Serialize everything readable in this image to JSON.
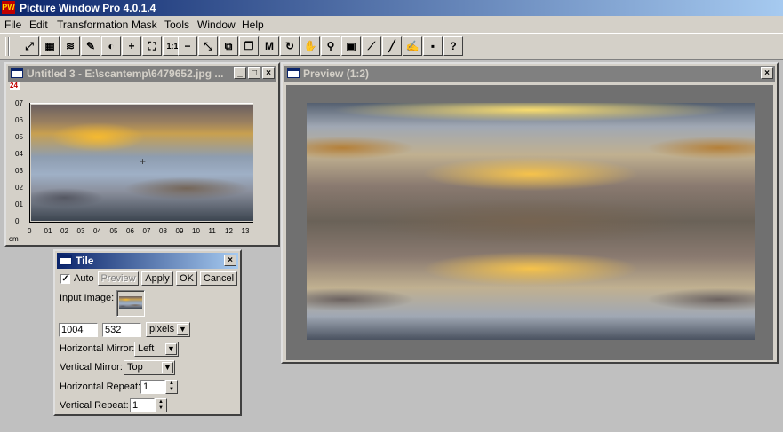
{
  "app": {
    "title": "Picture Window Pro 4.0.1.4",
    "logo": "PW"
  },
  "menu": [
    "File",
    "Edit",
    "Transformation",
    "Mask",
    "Tools",
    "Window",
    "Help"
  ],
  "toolbar": {
    "icons": [
      "transform-icon",
      "grid-icon",
      "waves-icon",
      "sharpen-icon",
      "brightness-icon",
      "plus-icon",
      "fit-icon",
      "one-to-one-icon",
      "minus-icon",
      "shrink-icon",
      "compare-icon",
      "copy-icon",
      "mask-icon",
      "circle-arrow-icon",
      "hand-icon",
      "magnifier-icon",
      "color-sample-icon",
      "brush-icon",
      "pen-icon",
      "paint-icon",
      "camera-icon",
      "help-icon"
    ],
    "glyphs": [
      "⤢",
      "▦",
      "≋",
      "✎",
      "◐",
      "+",
      "⛶",
      "1:1",
      "−",
      "⤡",
      "⧉",
      "❐",
      "M",
      "↻",
      "✋",
      "⚲",
      "▣",
      "⟋",
      "╱",
      "✍",
      "▪",
      "?"
    ]
  },
  "image_window": {
    "title": "Untitled 3 - E:\\scantemp\\6479652.jpg ...",
    "badge": "24",
    "unit": "cm",
    "y_ticks": [
      "07",
      "06",
      "05",
      "04",
      "03",
      "02",
      "01",
      "0"
    ],
    "x_ticks": [
      "0",
      "01",
      "02",
      "03",
      "04",
      "05",
      "06",
      "07",
      "08",
      "09",
      "10",
      "11",
      "12",
      "13"
    ]
  },
  "preview_window": {
    "title": "Preview (1:2)"
  },
  "tile_dialog": {
    "title": "Tile",
    "auto_label": "Auto",
    "auto_checked": true,
    "preview_button": "Preview",
    "apply_button": "Apply",
    "ok_button": "OK",
    "cancel_button": "Cancel",
    "input_image_label": "Input Image:",
    "width": "1004",
    "height": "532",
    "units": "pixels",
    "h_mirror_label": "Horizontal Mirror:",
    "h_mirror_value": "Left",
    "v_mirror_label": "Vertical Mirror:",
    "v_mirror_value": "Top",
    "h_repeat_label": "Horizontal Repeat:",
    "h_repeat_value": "1",
    "v_repeat_label": "Vertical Repeat:",
    "v_repeat_value": "1"
  }
}
